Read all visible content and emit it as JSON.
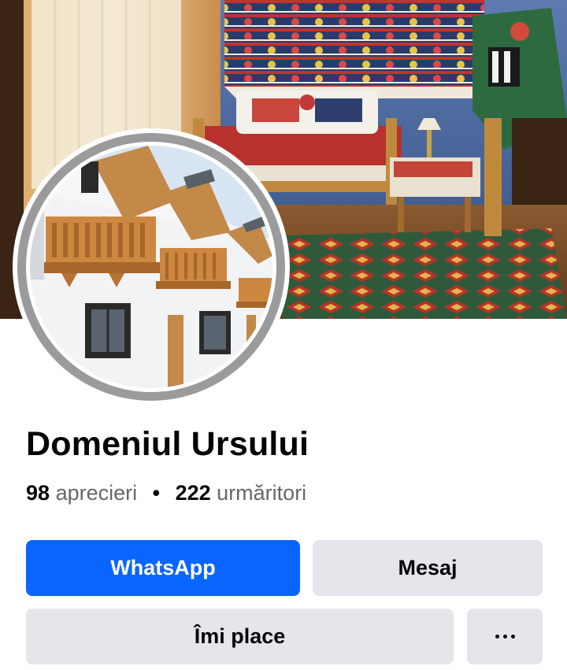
{
  "profile": {
    "name": "Domeniul Ursului",
    "likes_count": "98",
    "likes_label": "aprecieri",
    "separator": "•",
    "followers_count": "222",
    "followers_label": "urmăritori"
  },
  "actions": {
    "whatsapp_label": "WhatsApp",
    "message_label": "Mesaj",
    "like_label": "Îmi place",
    "more_icon": "more-horizontal-icon"
  },
  "colors": {
    "primary_button": "#0866ff",
    "secondary_button": "#e4e6eb",
    "text_primary": "#050505",
    "text_secondary": "#65676b"
  }
}
